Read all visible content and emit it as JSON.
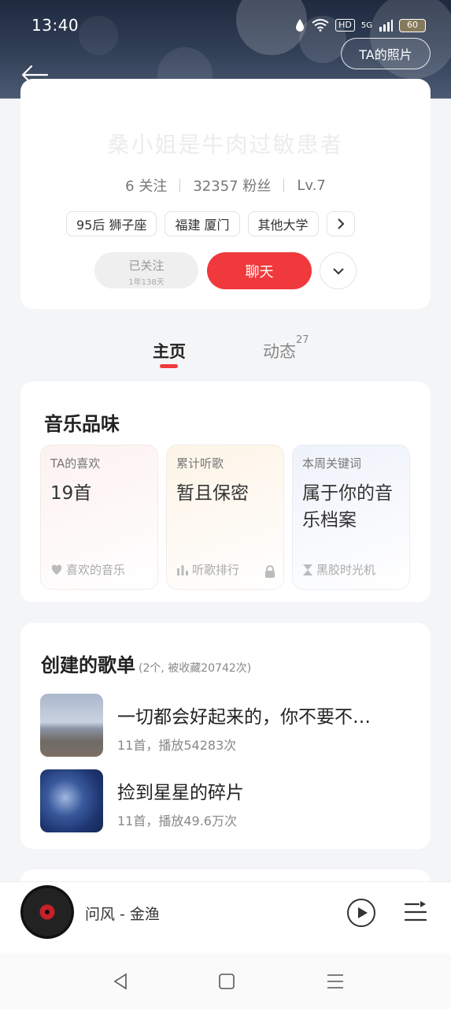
{
  "status_bar": {
    "time": "13:40",
    "hd_badge": "HD",
    "network": "5G",
    "battery": "60"
  },
  "header": {
    "photo_button": "TA的照片"
  },
  "profile": {
    "nickname": "桑小姐是牛肉过敏患者",
    "following": "6 关注",
    "fans": "32357 粉丝",
    "level": "Lv.7",
    "tags": [
      "95后 狮子座",
      "福建 厦门",
      "其他大学"
    ],
    "followed_label": "已关注",
    "followed_duration": "1年138天",
    "chat_label": "聊天"
  },
  "tabs": {
    "home": "主页",
    "feed": "动态",
    "feed_count": "27"
  },
  "music_taste": {
    "title": "音乐品味",
    "boxes": [
      {
        "label": "TA的喜欢",
        "value": "19首",
        "footer": "喜欢的音乐",
        "icon": "heart-icon"
      },
      {
        "label": "累计听歌",
        "value": "暂且保密",
        "footer": "听歌排行",
        "icon": "bar-chart-icon"
      },
      {
        "label": "本周关键词",
        "value": "属于你的音乐档案",
        "footer": "黑胶时光机",
        "icon": "hourglass-icon"
      }
    ]
  },
  "playlists": {
    "title": "创建的歌单",
    "subtitle": "(2个, 被收藏20742次)",
    "items": [
      {
        "name": "一切都会好起来的，你不要不…",
        "meta": "11首，播放54283次"
      },
      {
        "name": "捡到星星的碎片",
        "meta": "11首，播放49.6万次"
      }
    ]
  },
  "player": {
    "now_playing": "问风 - 金渔"
  },
  "colors": {
    "accent": "#f0393c",
    "header_bg": "#2a3550"
  }
}
